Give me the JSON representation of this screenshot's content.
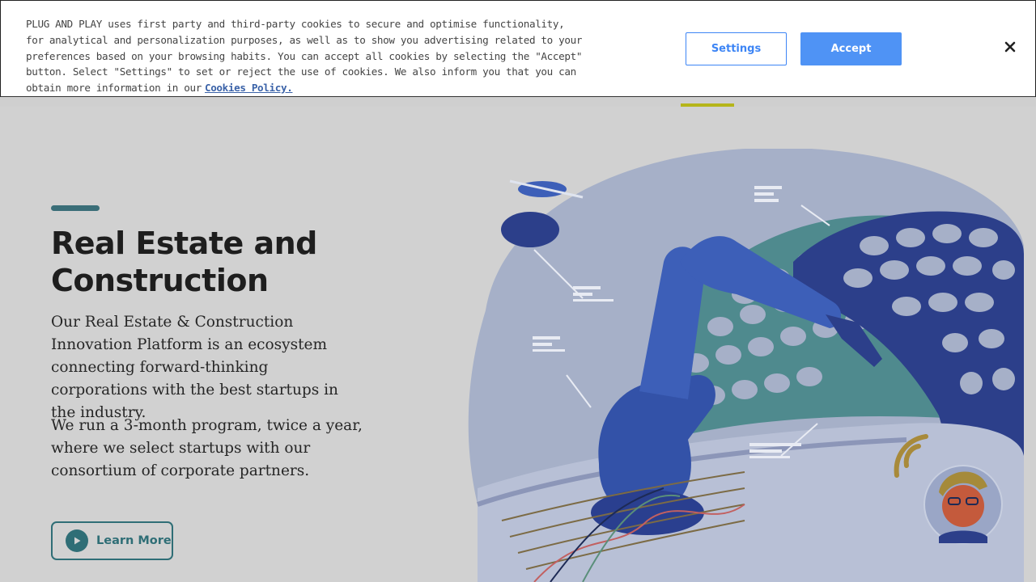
{
  "cookie_banner": {
    "text": "PLUG AND PLAY uses first party and third-party cookies to secure and optimise functionality, for analytical and personalization purposes, as well as to show you advertising related to your preferences based on your browsing habits. You can accept all cookies by selecting the \"Accept\" button. Select \"Settings\" to set or reject the use of cookies. We also inform you that you can obtain more information in our",
    "link_label": "Cookies Policy.",
    "settings_label": "Settings",
    "accept_label": "Accept",
    "close_icon": "close-icon"
  },
  "hero": {
    "title": "Real Estate and Construction",
    "paragraph_1": "Our Real Estate & Construction Innovation Platform is an ecosystem connecting forward-thinking corporations with the best startups in the industry.",
    "paragraph_2": "We run a 3-month program, twice a year, where we select startups with our consortium of corporate partners.",
    "cta_label": "Learn More",
    "cta_icon": "play-icon"
  },
  "colors": {
    "accent": "#2f6e76",
    "button_blue": "#4f93f5",
    "link_blue": "#3a62a8",
    "nav_indicator": "#b5b51a"
  }
}
